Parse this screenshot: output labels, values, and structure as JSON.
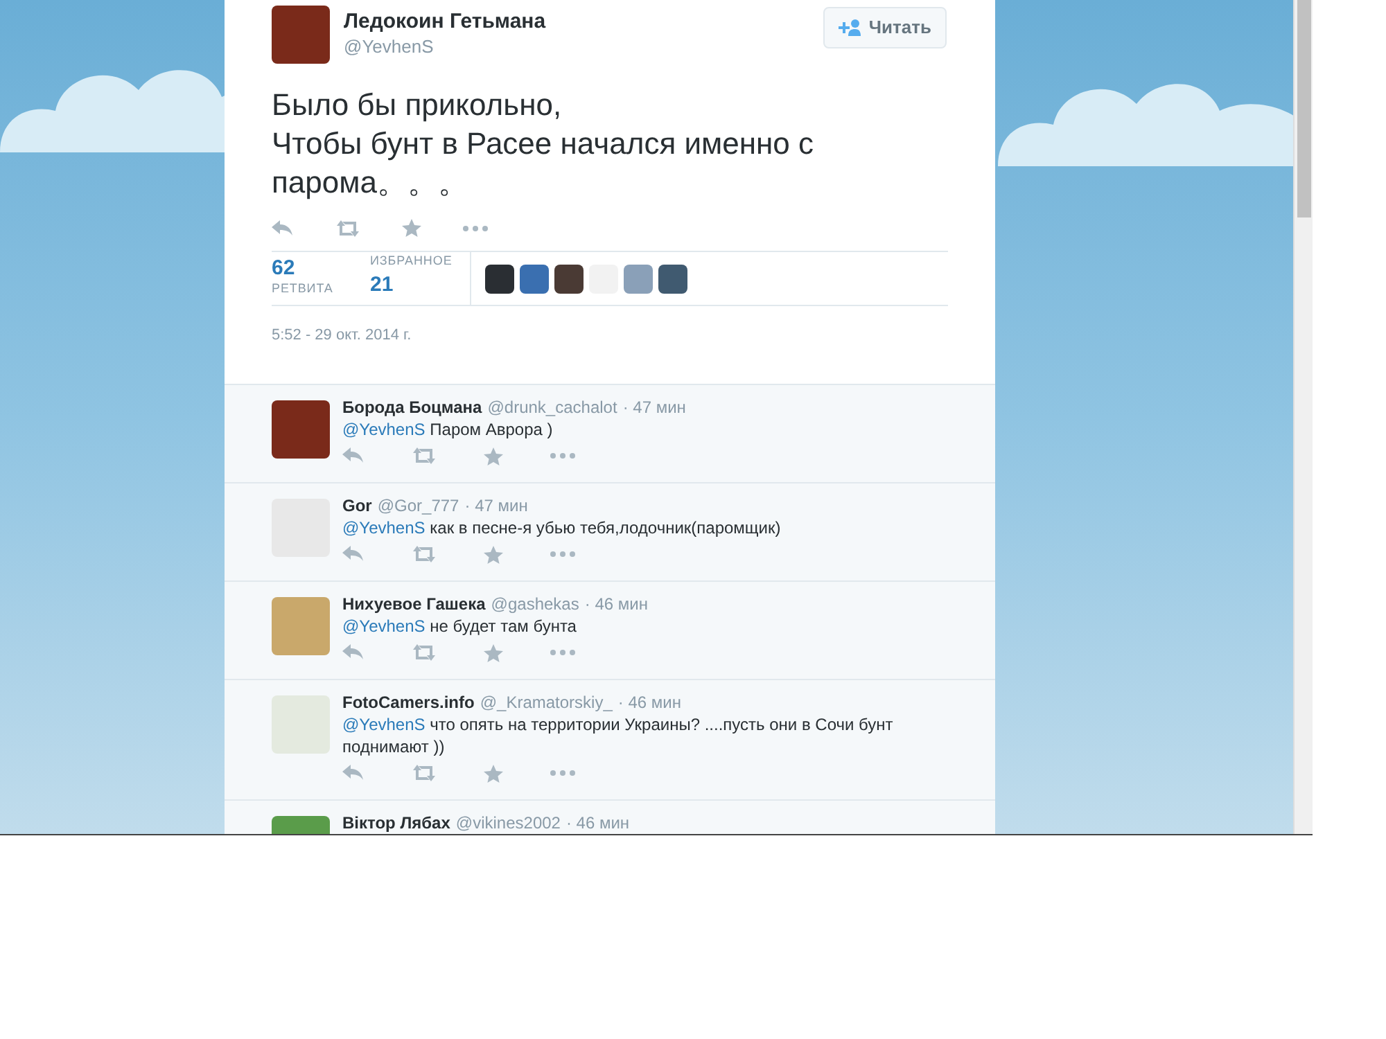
{
  "tweet": {
    "author": {
      "name": "Ледокоин Гетьмана",
      "handle": "@YevhenS"
    },
    "follow_button": {
      "label": "Читать"
    },
    "text_lines": [
      "Было бы прикольно,",
      "Чтобы бунт в Расее начался именно с",
      "парома。。。"
    ],
    "stats": [
      {
        "value": "62",
        "label": "РЕТВИТА"
      },
      {
        "value": "21",
        "label": "ИЗБРАННОЕ"
      }
    ],
    "timestamp": "5:52 - 29 окт. 2014 г."
  },
  "replies": [
    {
      "name": "Борода Боцмана",
      "handle": "@drunk_cachalot",
      "time": "· 47 мин",
      "mention": "@YevhenS",
      "text": "Паром Аврора )"
    },
    {
      "name": "Gor",
      "handle": "@Gor_777",
      "time": "· 47 мин",
      "mention": "@YevhenS",
      "text": "как в песне-я убью тебя,лодочник(паромщик)"
    },
    {
      "name": "Нихуевое Гашека",
      "handle": "@gashekas",
      "time": "· 46 мин",
      "mention": "@YevhenS",
      "text": "не будет там бунта"
    },
    {
      "name": "FotoCamers.info",
      "handle": "@_Kramatorskiy_",
      "time": "· 46 мин",
      "mention": "@YevhenS",
      "text": "что опять на территории Украины? ....пусть они в Сочи бунт поднимают ))"
    },
    {
      "name": "Віктор Лябах",
      "handle": "@vikines2002",
      "time": "· 46 мин"
    }
  ]
}
